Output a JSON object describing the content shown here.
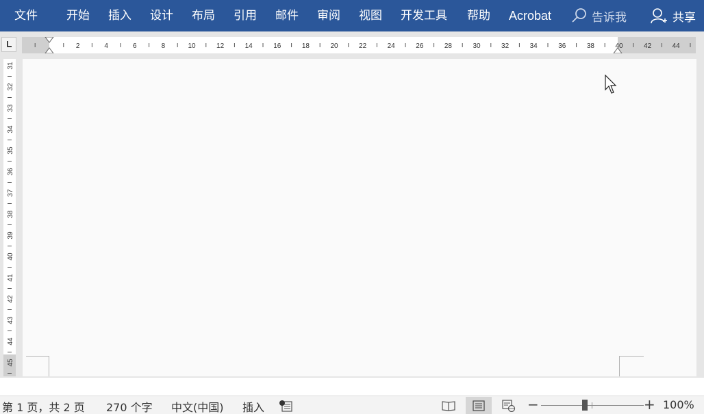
{
  "ribbon": {
    "tabs": [
      "文件",
      "开始",
      "插入",
      "设计",
      "布局",
      "引用",
      "邮件",
      "审阅",
      "视图",
      "开发工具",
      "帮助",
      "Acrobat"
    ],
    "tell_me": "告诉我",
    "share": "共享",
    "background": "#2b579a"
  },
  "ruler": {
    "horizontal_labels": [
      "2",
      "4",
      "6",
      "8",
      "10",
      "12",
      "14",
      "16",
      "18",
      "20",
      "22",
      "24",
      "26",
      "28",
      "30",
      "32",
      "34",
      "36",
      "38",
      "40",
      "42",
      "44"
    ],
    "vertical_labels": [
      "31",
      "32",
      "33",
      "34",
      "35",
      "36",
      "37",
      "38",
      "39",
      "40",
      "41",
      "42",
      "43",
      "44",
      "45"
    ]
  },
  "statusbar": {
    "page": "第 1 页，共 2 页",
    "words": "270 个字",
    "language": "中文(中国)",
    "mode": "插入",
    "zoom": "100%",
    "zoom_fraction": 0.5
  }
}
